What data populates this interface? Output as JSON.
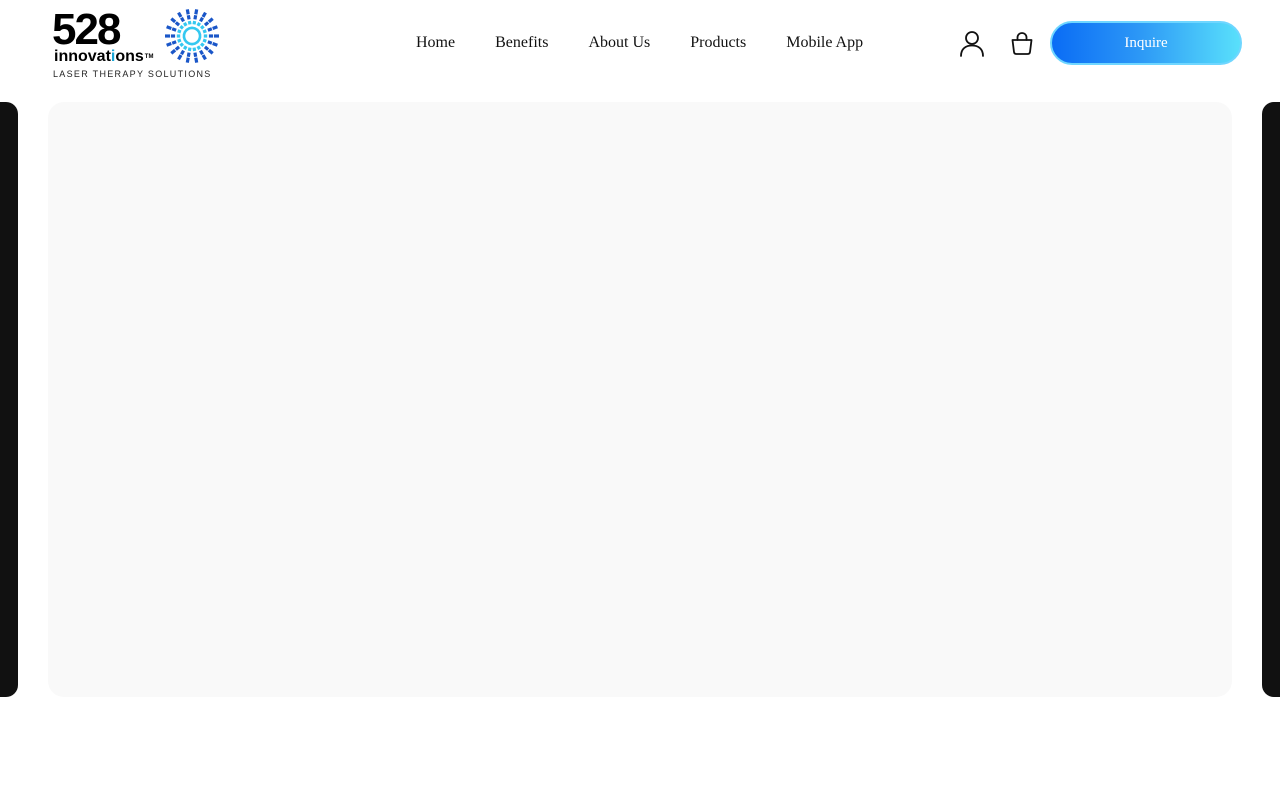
{
  "logo": {
    "number": "528",
    "word_before": "innovat",
    "word_highlight": "i",
    "word_after": "ons",
    "trademark": "TM",
    "tagline": "LASER THERAPY SOLUTIONS",
    "icon": "starburst-icon",
    "colors": {
      "dark_blue": "#1a56c8",
      "light_blue": "#34c8f0"
    }
  },
  "nav": {
    "items": [
      {
        "label": "Home"
      },
      {
        "label": "Benefits"
      },
      {
        "label": "About Us"
      },
      {
        "label": "Products"
      },
      {
        "label": "Mobile App"
      }
    ]
  },
  "header_actions": {
    "account_icon": "user-icon",
    "cart_icon": "shopping-bag-icon",
    "inquire_label": "Inquire"
  },
  "hero": {
    "slide_background": "#f9f9f9",
    "peek_slide_color": "#111111"
  },
  "colors": {
    "accent_start": "#0a6cf5",
    "accent_end": "#59e0fb"
  }
}
